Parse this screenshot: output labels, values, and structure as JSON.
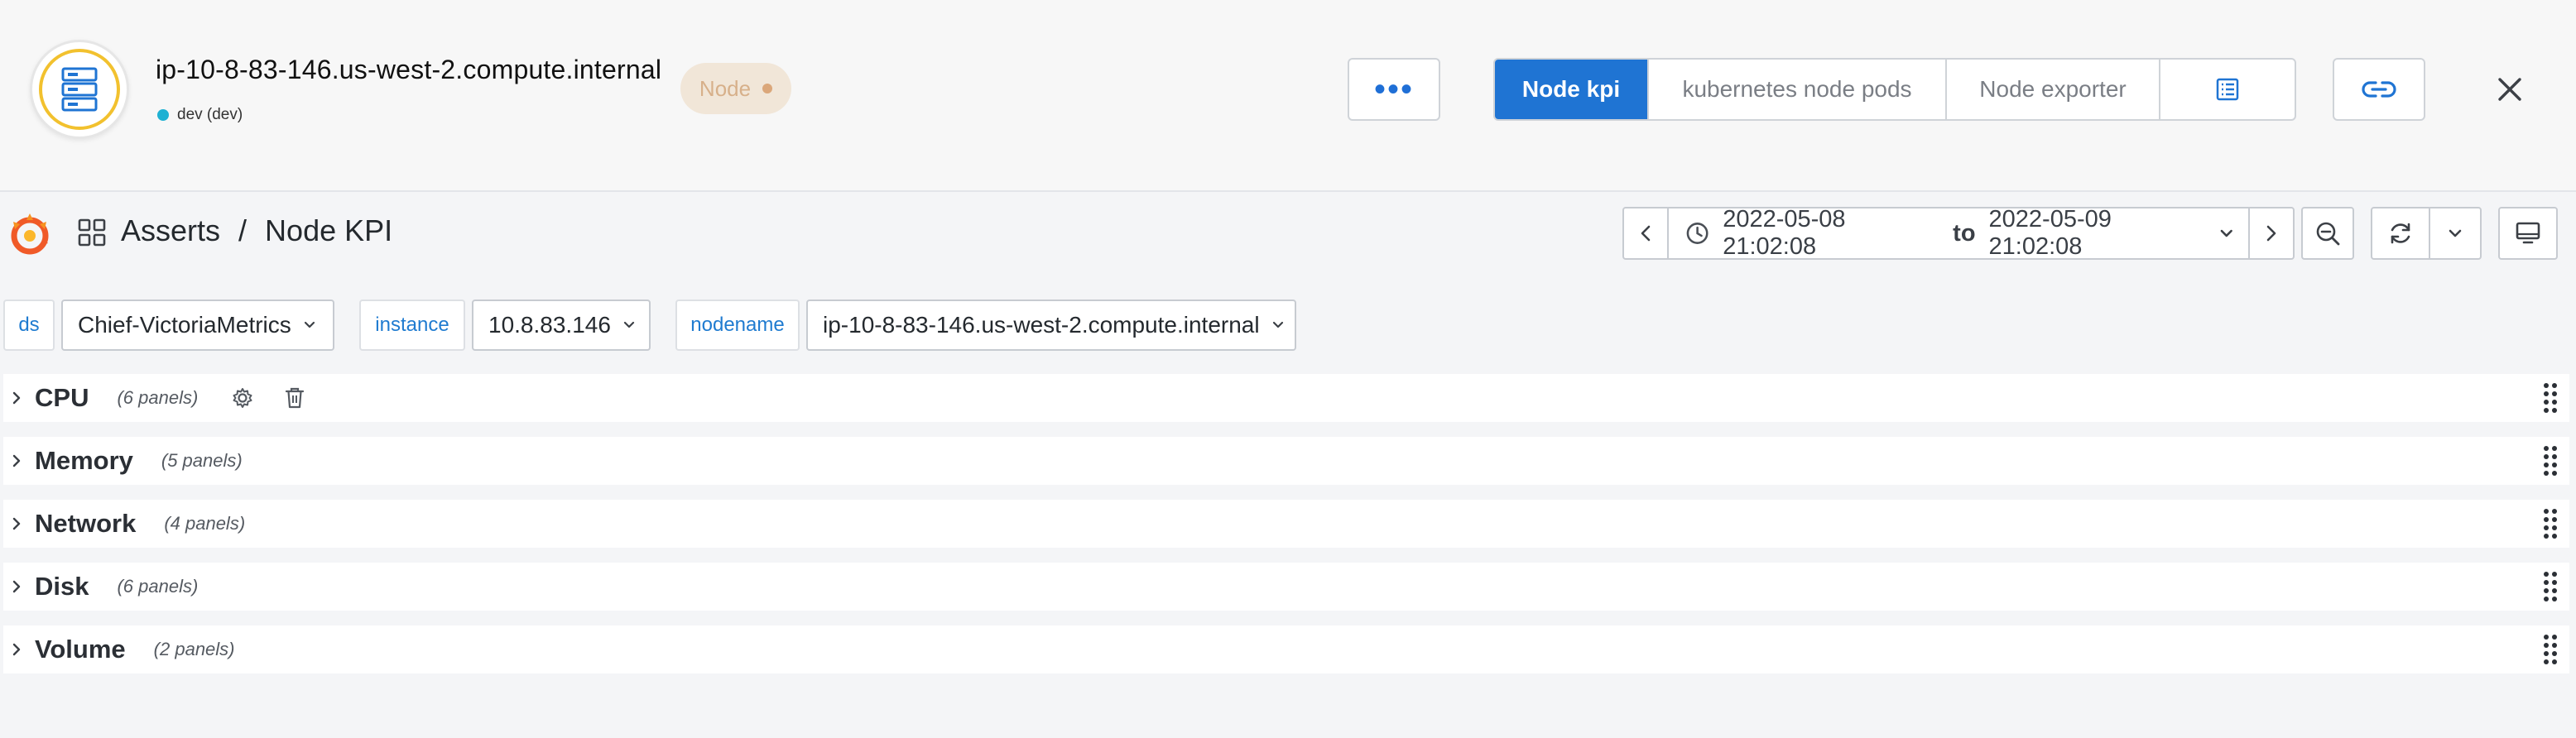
{
  "entity": {
    "name": "ip-10-8-83-146.us-west-2.compute.internal",
    "environment": "dev (dev)",
    "type_label": "Node",
    "more_label": "•••",
    "tabs": [
      {
        "label": "Node kpi",
        "active": true
      },
      {
        "label": "kubernetes node pods",
        "active": false
      },
      {
        "label": "Node exporter",
        "active": false
      }
    ]
  },
  "dashboard": {
    "breadcrumb_folder": "Asserts",
    "breadcrumb_separator": "/",
    "breadcrumb_title": "Node KPI",
    "time_from": "2022-05-08 21:02:08",
    "time_to_word": "to",
    "time_to": "2022-05-09 21:02:08"
  },
  "variables": [
    {
      "label": "ds",
      "value": "Chief-VictoriaMetrics"
    },
    {
      "label": "instance",
      "value": "10.8.83.146"
    },
    {
      "label": "nodename",
      "value": "ip-10-8-83-146.us-west-2.compute.internal"
    }
  ],
  "rows": [
    {
      "title": "CPU",
      "count": "(6 panels)"
    },
    {
      "title": "Memory",
      "count": "(5 panels)"
    },
    {
      "title": "Network",
      "count": "(4 panels)"
    },
    {
      "title": "Disk",
      "count": "(6 panels)"
    },
    {
      "title": "Volume",
      "count": "(2 panels)"
    }
  ],
  "colors": {
    "accent": "#1f74d3",
    "ring": "#f2c12e",
    "env_dot": "#1fb1d3",
    "pill_bg": "#f1e6d8"
  },
  "icons": {
    "avatar": "server-icon",
    "link": "link-icon",
    "close": "close-icon",
    "list": "list-icon",
    "grafana": "grafana-logo-icon",
    "apps": "apps-grid-icon",
    "clock": "clock-icon",
    "zoom": "zoom-out-icon",
    "refresh": "refresh-icon",
    "tv": "tv-mode-icon",
    "drag": "drag-handle-icon"
  }
}
